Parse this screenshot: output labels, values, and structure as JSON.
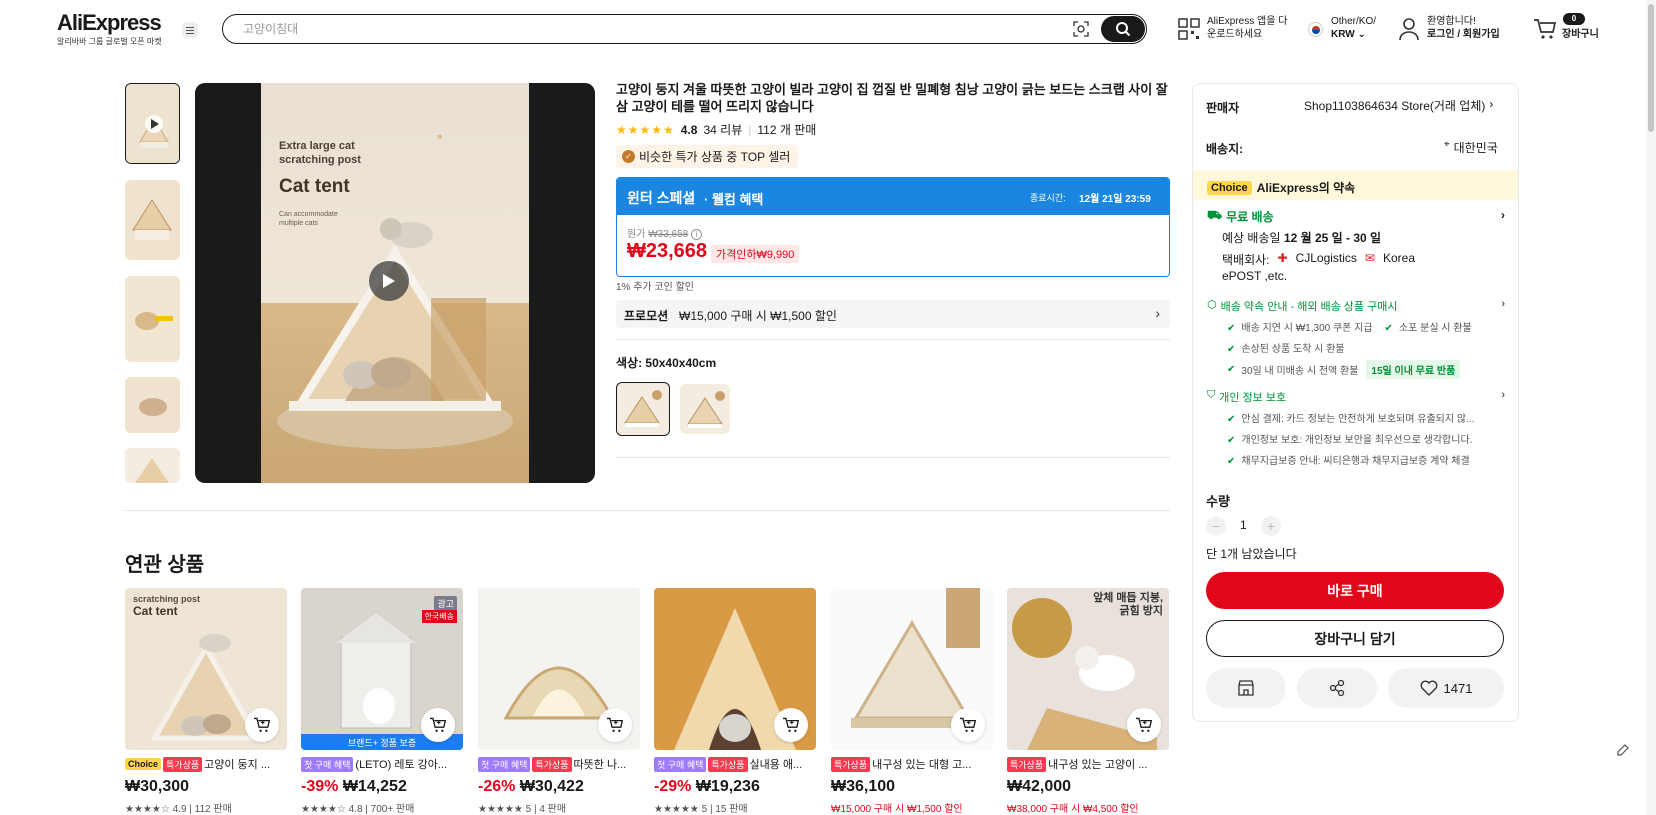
{
  "header": {
    "logo": "AliExpress",
    "logo_sub": "알리바바 그룹 글로벌 오픈 마켓",
    "search_placeholder": "고양이침대",
    "app_line1": "AliExpress 앱을 다",
    "app_line2": "운로드하세요",
    "region_line1": "Other/KO/",
    "region_line2": "KRW",
    "account_line1": "환영합니다!",
    "account_line2": "로그인 / 회원가입",
    "cart_count": "0",
    "cart_label": "장바구니"
  },
  "gallery": {
    "poster_line1": "Extra large cat",
    "poster_line2": "scratching post",
    "poster_title": "Cat tent",
    "poster_sub": "Can accommodate multiple cats"
  },
  "product": {
    "title": "고양이 둥지 겨울 따뜻한 고양이 빌라 고양이 집 껍질 반 밀폐형 침낭 고양이 긁는 보드는 스크랩 사이 잘삼 고양이 테를 떨어 뜨리지 않습니다",
    "rating": "4.8",
    "reviews": "34 리뷰",
    "sold": "112 개 판매",
    "top_seller": "비슷한 특가 상품 중 TOP 셀러",
    "promo_title": "윈터 스페셜",
    "promo_sub": "· 웰컴 혜택",
    "promo_end_label": "종료시간:",
    "promo_end": "12월 21일 23:59",
    "orig_label": "원가",
    "orig_price": "₩33,658",
    "price": "₩23,668",
    "discount_badge": "가격인하₩9,990",
    "coin": "1% 추가 코인 할인",
    "coupon_label": "프로모션",
    "coupon_text": "₩15,000 구매 시 ₩1,500 할인",
    "color_label": "색상: 50x40x40cm"
  },
  "panel": {
    "seller_label": "판매자",
    "seller_name": "Shop1103864634 Store(거래 업체)",
    "ship_label": "배송지:",
    "ship_dest": "대한민국",
    "choice_tag": "Choice",
    "choice_text": "AliExpress의 약속",
    "free_ship": "무료 배송",
    "delivery_label": "예상 배송일",
    "delivery_date": "12 월 25 일 - 30 일",
    "carrier_label": "택배회사:",
    "carrier1": "CJLogistics",
    "carrier2": "Korea",
    "carrier3": "ePOST ,etc.",
    "promise_title": "배송 약속 안내 - 해외 배송 상품 구매시",
    "promise_items": [
      "배송 지연 시 ₩1,300 쿠폰 지급",
      "소포 분실 시 환불",
      "손상된 상품 도착 시 환불",
      "30일 내 미배송 시 전액 환불"
    ],
    "return_badge": "15일 이내 무료 반품",
    "privacy_title": "개인 정보 보호",
    "privacy_items": [
      "안심 결제: 카드 정보는 안전하게 보호되며 유출되지 않...",
      "개인정보 보호: 개인정보 보안을 최우선으로 생각합니다.",
      "채무지급보증 안내: 씨티은행과 채무지급보증 계약 체결"
    ],
    "qty_label": "수량",
    "qty": "1",
    "stock": "단 1개 남았습니다",
    "buy_now": "바로 구매",
    "add_cart": "장바구니 담기",
    "wish_count": "1471"
  },
  "related": {
    "title": "연관 상품",
    "cards": [
      {
        "tags": [
          [
            "c",
            "Choice"
          ],
          [
            "r",
            "특가상품"
          ]
        ],
        "name": "고양이 둥지 ...",
        "disc": "",
        "price": "₩30,300",
        "meta": "★★★★☆ 4.9 | 112 판매",
        "red": ""
      },
      {
        "tags": [
          [
            "p",
            "첫 구매 혜택"
          ]
        ],
        "name": "(LETO) 레토 강아...",
        "disc": "-39%",
        "price": "₩14,252",
        "meta": "★★★★☆ 4.8 | 700+ 판매",
        "red": ""
      },
      {
        "tags": [
          [
            "p",
            "첫 구매 혜택"
          ],
          [
            "r",
            "특가상품"
          ]
        ],
        "name": "따뜻한 나...",
        "disc": "-26%",
        "price": "₩30,422",
        "meta": "★★★★★ 5 | 4 판매",
        "red": ""
      },
      {
        "tags": [
          [
            "p",
            "첫 구매 혜택"
          ],
          [
            "r",
            "특가상품"
          ]
        ],
        "name": "실내용 애...",
        "disc": "-29%",
        "price": "₩19,236",
        "meta": "★★★★★ 5 | 15 판매",
        "red": ""
      },
      {
        "tags": [
          [
            "r",
            "특가상품"
          ]
        ],
        "name": "내구성 있는 대형 고...",
        "disc": "",
        "price": "₩36,100",
        "meta": "",
        "red": "₩15,000 구매 시 ₩1,500 할인"
      },
      {
        "tags": [
          [
            "r",
            "특가상품"
          ]
        ],
        "name": "내구성 있는 고양이 ...",
        "disc": "",
        "price": "₩42,000",
        "meta": "",
        "red": "₩38,000 구매 시 ₩4,500 할인"
      }
    ],
    "card2_ad": "광고",
    "card2_badge": "한국배송",
    "card2_brand": "브랜드+ 정품 보증",
    "card6_text1": "앞체 매듭 지붕,",
    "card6_text2": "긁힘 방지"
  },
  "colors": {
    "accent": "#e2061a",
    "promo_blue": "#1a86e0",
    "choice_yellow": "#ffd54d",
    "green": "#00913a"
  }
}
